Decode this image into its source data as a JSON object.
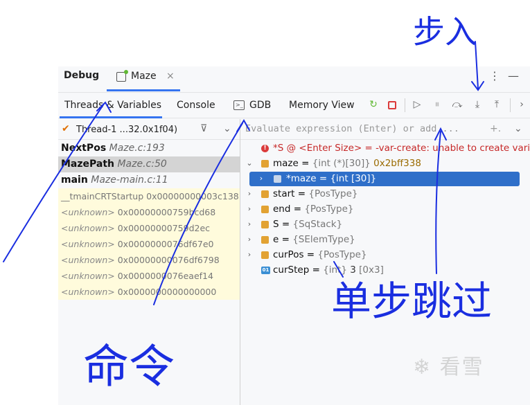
{
  "header": {
    "title": "Debug",
    "session_tab": "Maze",
    "close_glyph": "×",
    "more_glyph": "⋮",
    "minimize_glyph": "—"
  },
  "tabs": [
    {
      "label": "Threads & Variables"
    },
    {
      "label": "Console"
    },
    {
      "label": "GDB"
    },
    {
      "label": "Memory View"
    }
  ],
  "toolbar_icons": [
    "rerun-icon",
    "stop-icon",
    "resume-icon",
    "pause-icon",
    "step-over-icon",
    "step-into-icon",
    "step-out-icon",
    "more-chevron-icon"
  ],
  "thread": {
    "label": "Thread-1 ...32.0x1f04)"
  },
  "evaluate": {
    "placeholder": "Evaluate expression (Enter) or add ..."
  },
  "frames": [
    {
      "fn": "NextPos",
      "loc": "Maze.c:193"
    },
    {
      "fn": "MazePath",
      "loc": "Maze.c:50",
      "selected": true
    },
    {
      "fn": "main",
      "loc": "Maze-main.c:11"
    },
    {
      "fn": "__tmainCRTStartup",
      "addr": "0x00000000003c138"
    },
    {
      "fn": "<unknown>",
      "addr": "0x00000000759bcd68"
    },
    {
      "fn": "<unknown>",
      "addr": "0x00000000759d2ec"
    },
    {
      "fn": "<unknown>",
      "addr": "0x0000000076df67e0"
    },
    {
      "fn": "<unknown>",
      "addr": "0x00000000076df6798"
    },
    {
      "fn": "<unknown>",
      "addr": "0x0000000076eaef14"
    },
    {
      "fn": "<unknown>",
      "addr": "0x0000000000000000"
    }
  ],
  "variables": {
    "error": "*S @ <Enter Size> = -var-create: unable to create varial",
    "maze": {
      "name": "maze",
      "type": "{int (*)[30]}",
      "value": "0x2bff338"
    },
    "maze_child": {
      "text": "*maze = {int [30]}"
    },
    "start": {
      "name": "start",
      "type": "{PosType}"
    },
    "end": {
      "name": "end",
      "type": "{PosType}"
    },
    "S": {
      "name": "S",
      "type": "{SqStack}"
    },
    "e": {
      "name": "e",
      "type": "{SElemType}"
    },
    "curPos": {
      "name": "curPos",
      "type": "{PosType}"
    },
    "curStep": {
      "name": "curStep",
      "type": "{int}",
      "value": "3",
      "hex": "[0x3]",
      "icon": "01"
    }
  },
  "annotations": {
    "top_right": "步入",
    "bottom_left": "命令",
    "bottom_right": "单步跳过"
  },
  "watermark": "❄ 看雪",
  "colors": {
    "accent": "#3574f0",
    "selection": "#2f6fc9",
    "ink": "#1a2ee0",
    "error": "#c62828"
  }
}
